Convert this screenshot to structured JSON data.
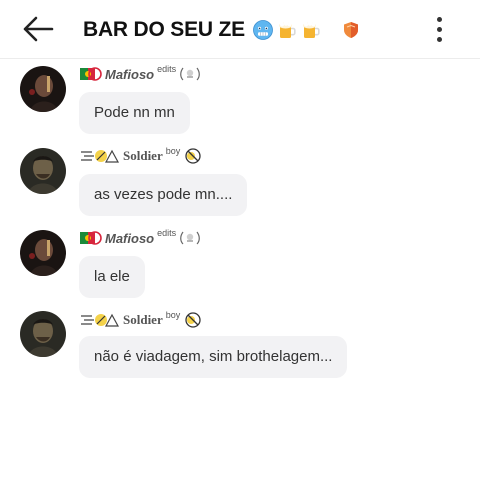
{
  "header": {
    "title": "BAR DO SEU ZE",
    "title_emojis": [
      "cold-face-emoji",
      "beer-mug-emoji",
      "beer-mug-emoji",
      "shield-emoji"
    ]
  },
  "messages": [
    {
      "author": "Mafioso",
      "author_suffix": "edits",
      "text": "Pode nn mn",
      "avatar": "mafioso-avatar"
    },
    {
      "author": "Soldier",
      "author_suffix": "boy",
      "text": "as vezes pode mn....",
      "avatar": "soldier-avatar"
    },
    {
      "author": "Mafioso",
      "author_suffix": "edits",
      "text": "la ele",
      "avatar": "mafioso-avatar"
    },
    {
      "author": "Soldier",
      "author_suffix": "boy",
      "text": "não é viadagem, sim brothelagem...",
      "avatar": "soldier-avatar"
    }
  ],
  "colors": {
    "bubble_bg": "#f2f2f4",
    "header_border": "#ececec",
    "text": "#333333"
  }
}
